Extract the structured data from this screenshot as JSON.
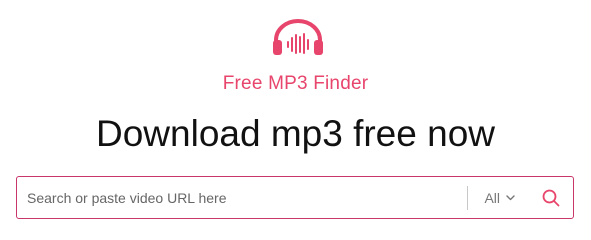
{
  "brand": {
    "logo_icon": "headphones-soundwave-icon",
    "name": "Free MP3 Finder",
    "accent_color": "#e8456c"
  },
  "headline": "Download mp3 free now",
  "search": {
    "placeholder": "Search or paste video URL here",
    "value": "",
    "filter_label": "All",
    "filter_icon": "chevron-down-icon",
    "submit_icon": "search-icon",
    "border_color": "#c8366a"
  }
}
